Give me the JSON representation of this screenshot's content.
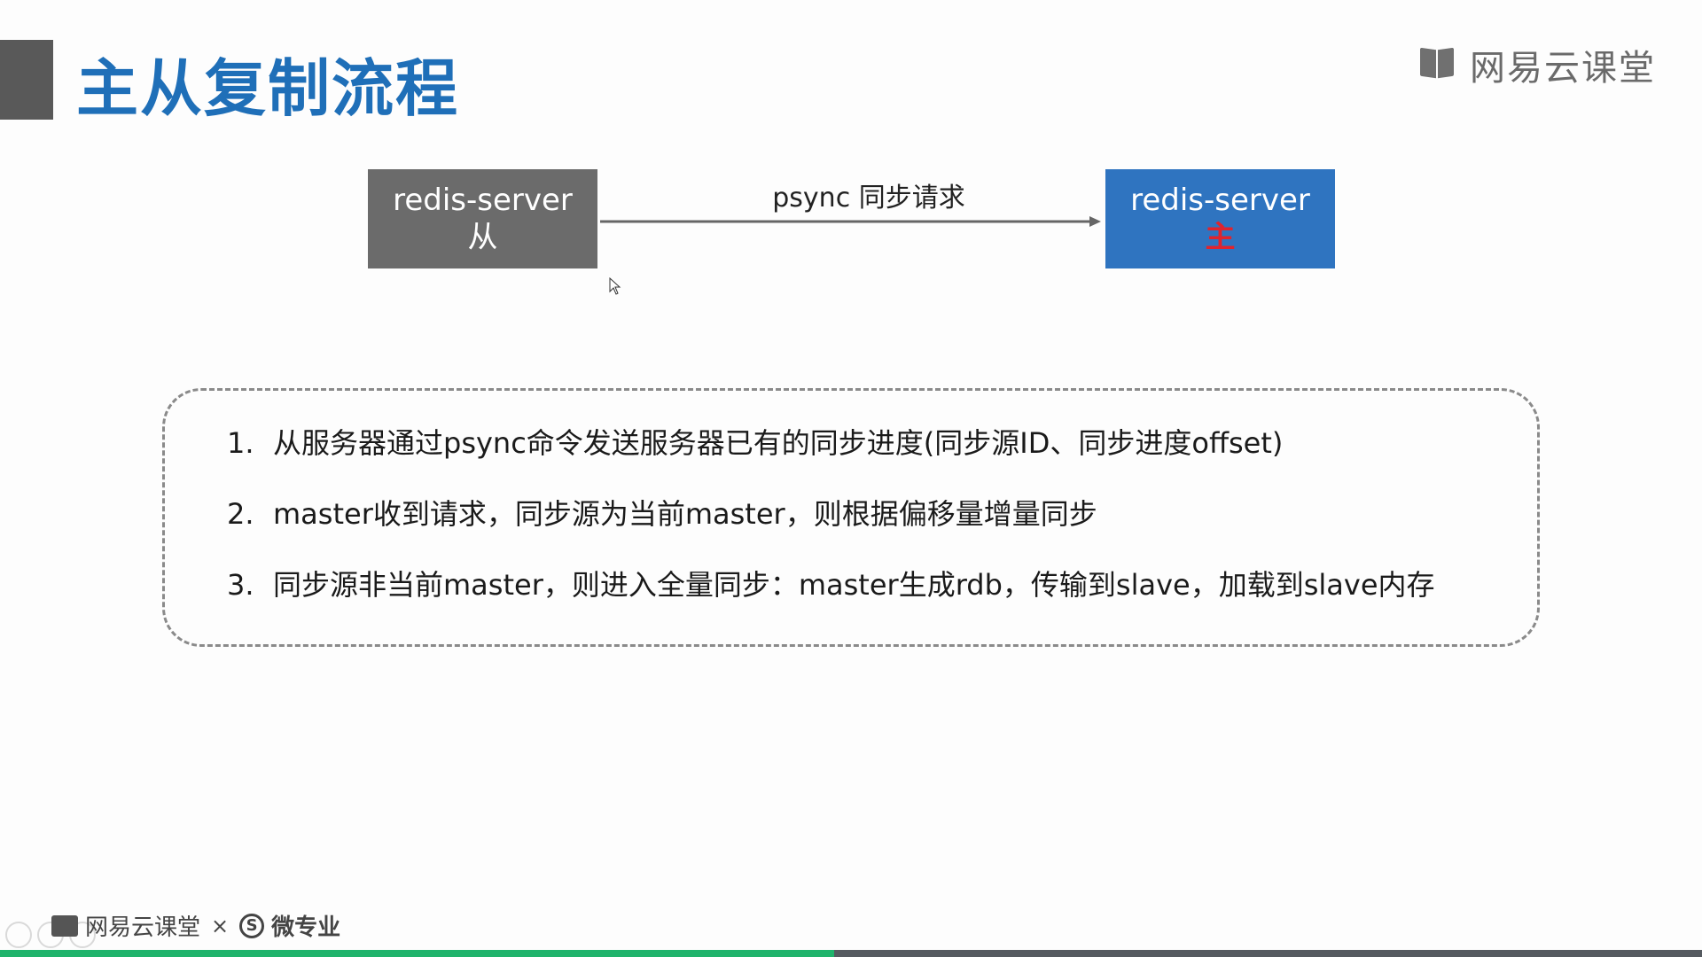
{
  "slide": {
    "title": "主从复制流程",
    "brand": "网易云课堂"
  },
  "diagram": {
    "slave": {
      "label": "redis-server",
      "role": "从"
    },
    "master": {
      "label": "redis-server",
      "role": "主"
    },
    "arrow_label": "psync 同步请求"
  },
  "steps": [
    {
      "num": "1.",
      "text": "从服务器通过psync命令发送服务器已有的同步进度(同步源ID、同步进度offset)"
    },
    {
      "num": "2.",
      "text": "master收到请求，同步源为当前master，则根据偏移量增量同步"
    },
    {
      "num": "3.",
      "text": "同步源非当前master，则进入全量同步：master生成rdb，传输到slave，加载到slave内存"
    }
  ],
  "footer": {
    "brand": "网易云课堂",
    "cross": "×",
    "partner_icon": "S",
    "partner": "微专业"
  },
  "player": {
    "progress": 0.49
  },
  "colors": {
    "title": "#1f6fb8",
    "slave_box": "#6b6b6b",
    "master_box": "#2f74c0",
    "master_role": "#e0242e",
    "progress": "#1fb36b"
  }
}
